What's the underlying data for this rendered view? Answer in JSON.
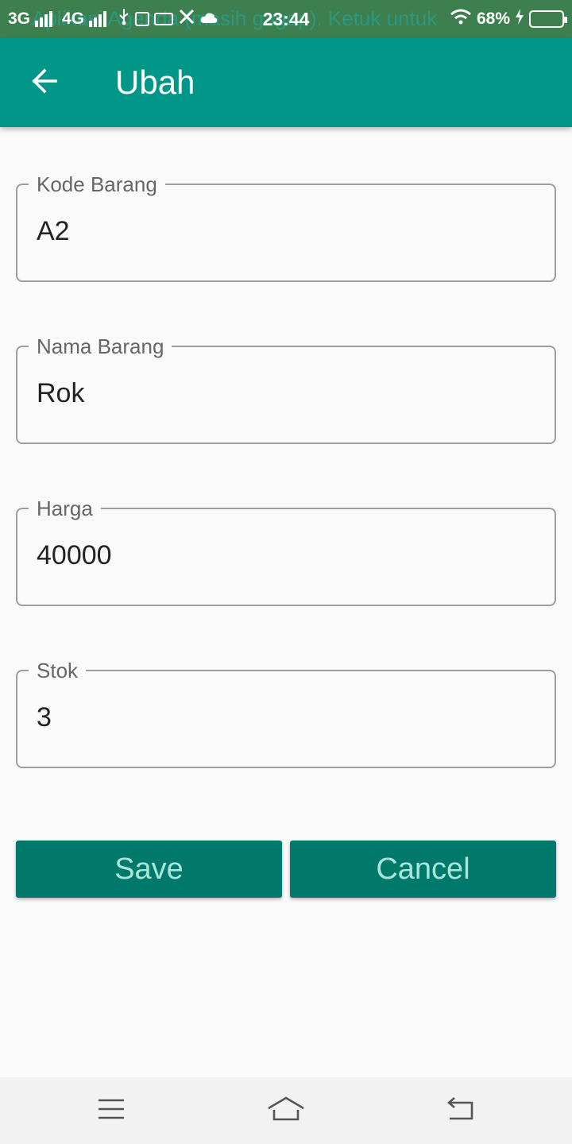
{
  "status_bar": {
    "ghost_text": "Aplikasi Agenda (masih gagap). Ketuk untuk",
    "network_1": "3G",
    "network_2": "4G",
    "time": "23:44",
    "battery_percent": "68%",
    "battery_level": 0.68
  },
  "app_bar": {
    "title": "Ubah"
  },
  "form": {
    "fields": [
      {
        "label": "Kode Barang",
        "value": "A2"
      },
      {
        "label": "Nama Barang",
        "value": "Rok"
      },
      {
        "label": "Harga",
        "value": "40000"
      },
      {
        "label": "Stok",
        "value": "3"
      }
    ]
  },
  "buttons": {
    "save_label": "Save",
    "cancel_label": "Cancel"
  },
  "colors": {
    "primary": "#009688",
    "primary_dark": "#00796b",
    "status_bar": "#3e7f4f",
    "background": "#fafafa"
  },
  "icons": {
    "back": "arrow-left-icon",
    "nav_menu": "menu-icon",
    "nav_home": "home-icon",
    "nav_back": "back-icon"
  }
}
